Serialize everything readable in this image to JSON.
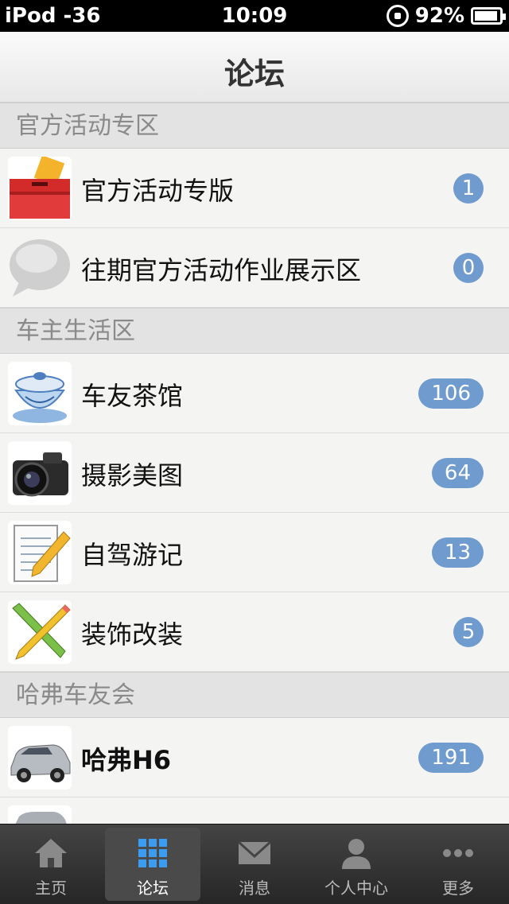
{
  "status_bar": {
    "carrier": "iPod -36",
    "time": "10:09",
    "battery": "92%"
  },
  "navbar": {
    "title": "论坛"
  },
  "sections": [
    {
      "title": "官方活动专区",
      "rows": [
        {
          "label": "官方活动专版",
          "badge": "1",
          "icon": "ballot-box-icon"
        },
        {
          "label": "往期官方活动作业展示区",
          "badge": "0",
          "icon": "speech-bubble-icon"
        }
      ]
    },
    {
      "title": "车主生活区",
      "rows": [
        {
          "label": "车友茶馆",
          "badge": "106",
          "icon": "teacup-icon"
        },
        {
          "label": "摄影美图",
          "badge": "64",
          "icon": "camera-icon"
        },
        {
          "label": "自驾游记",
          "badge": "13",
          "icon": "notepad-pencil-icon"
        },
        {
          "label": "装饰改装",
          "badge": "5",
          "icon": "pencil-brush-icon"
        }
      ]
    },
    {
      "title": "哈弗车友会",
      "rows": [
        {
          "label": "哈弗H6",
          "badge": "191",
          "icon": "suv-car-icon"
        }
      ]
    }
  ],
  "tabbar": [
    {
      "label": "主页",
      "icon": "home-icon",
      "active": false
    },
    {
      "label": "论坛",
      "icon": "grid-icon",
      "active": true
    },
    {
      "label": "消息",
      "icon": "envelope-icon",
      "active": false
    },
    {
      "label": "个人中心",
      "icon": "person-icon",
      "active": false
    },
    {
      "label": "更多",
      "icon": "more-dots-icon",
      "active": false
    }
  ]
}
